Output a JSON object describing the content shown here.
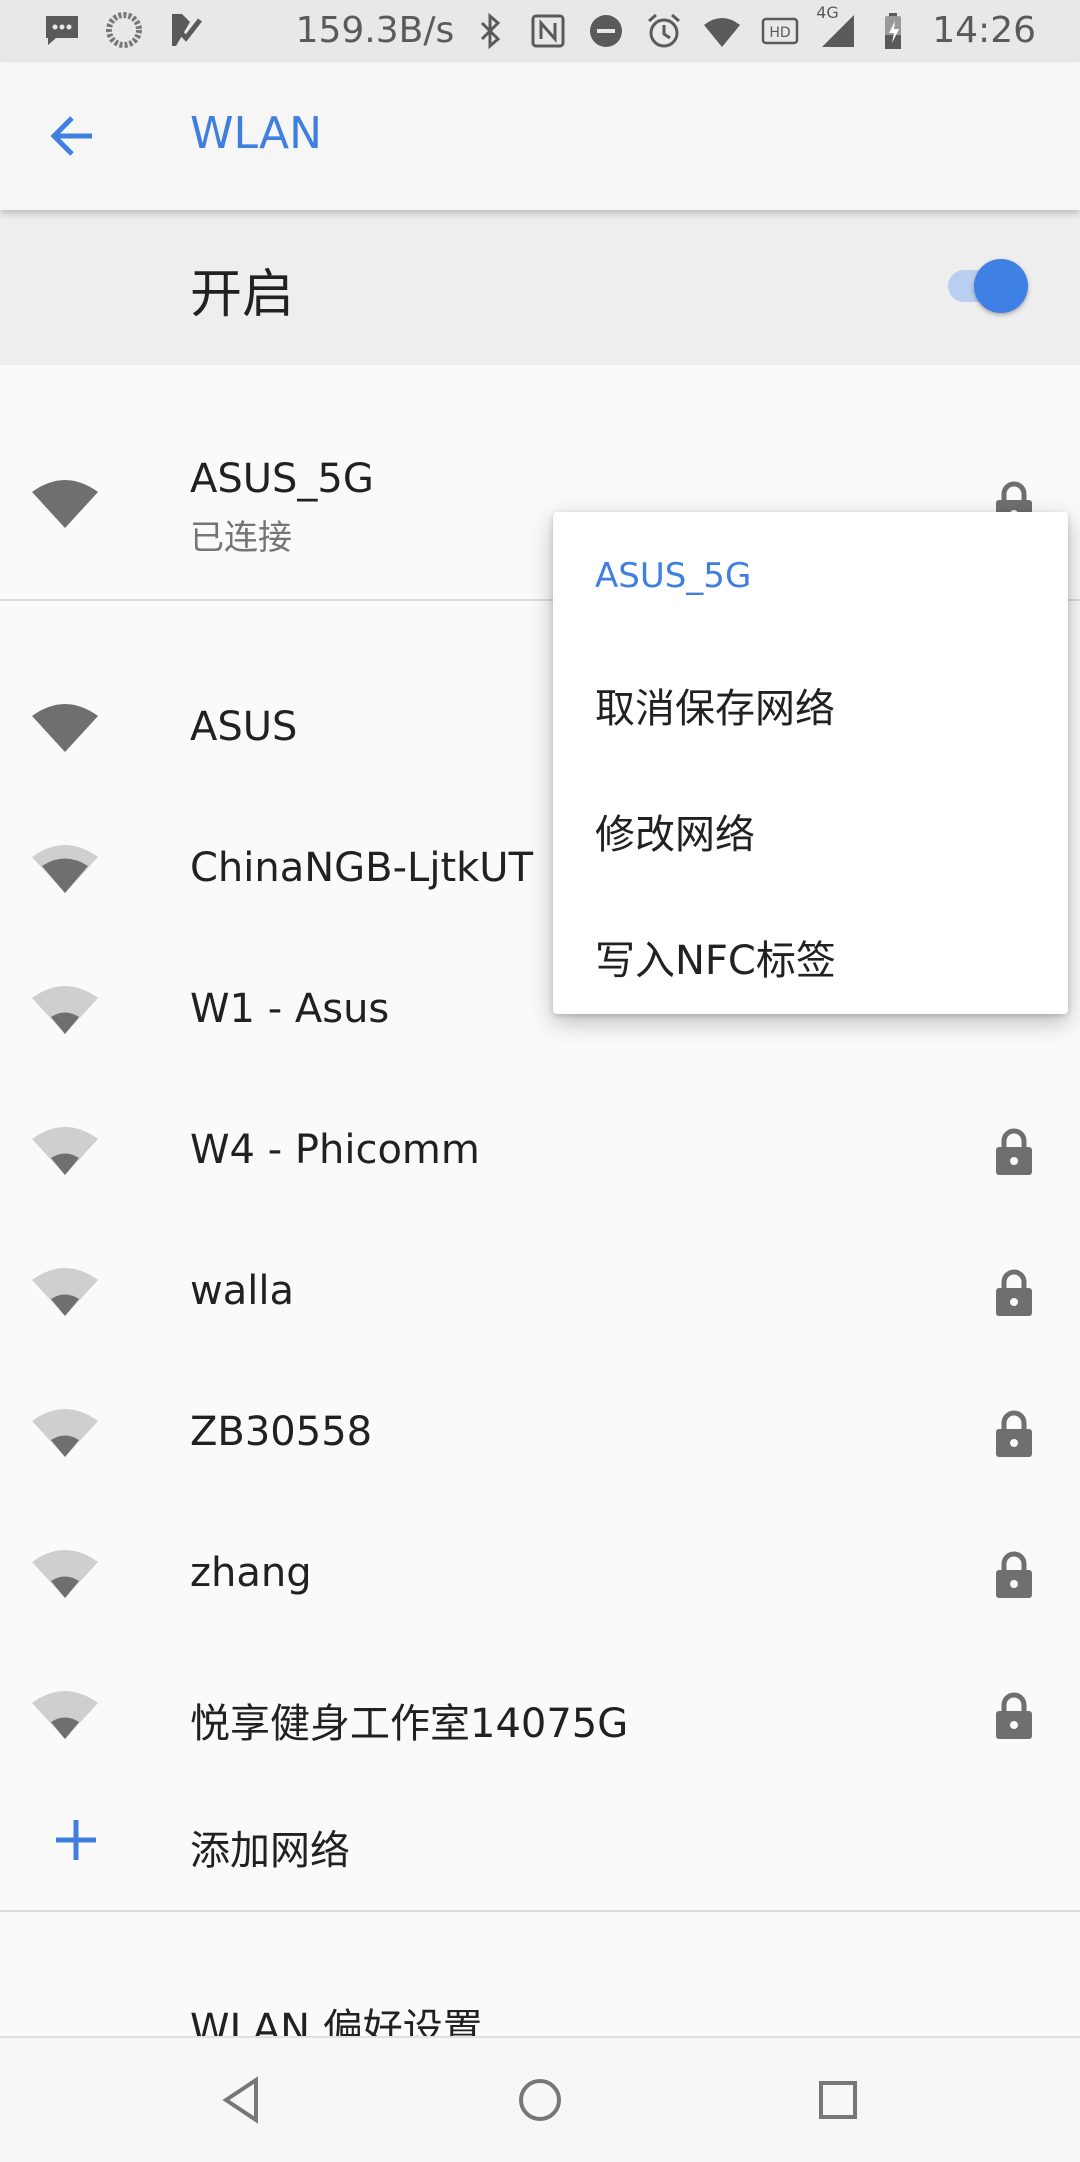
{
  "status_bar": {
    "speed": "159.3B/s",
    "network_type": "4G",
    "hd": "HD",
    "time": "14:26",
    "left_icons": [
      "message-icon",
      "sync-icon",
      "checklist-icon"
    ],
    "right_icons": [
      "bluetooth-icon",
      "nfc-icon",
      "dnd-icon",
      "alarm-icon",
      "wifi-icon",
      "signal-icon",
      "battery-icon"
    ]
  },
  "app_bar": {
    "title": "WLAN",
    "back_icon": "arrow-left-icon"
  },
  "wifi_switch": {
    "label": "开启",
    "enabled": true
  },
  "connected_network": {
    "ssid": "ASUS_5G",
    "status": "已连接",
    "secured": true
  },
  "networks": [
    {
      "ssid": "ASUS",
      "secured": false,
      "signal": 4
    },
    {
      "ssid": "ChinaNGB-LjtkUT",
      "secured": false,
      "signal": 3
    },
    {
      "ssid": "W1 - Asus",
      "secured": false,
      "signal": 2
    },
    {
      "ssid": "W4 - Phicomm",
      "secured": true,
      "signal": 2
    },
    {
      "ssid": "walla",
      "secured": true,
      "signal": 2
    },
    {
      "ssid": "ZB30558",
      "secured": true,
      "signal": 2
    },
    {
      "ssid": "zhang",
      "secured": true,
      "signal": 2
    },
    {
      "ssid": "悦享健身工作室14075G",
      "secured": true,
      "signal": 2
    }
  ],
  "add_network": {
    "label": "添加网络"
  },
  "preferences": {
    "label": "WLAN 偏好设置"
  },
  "context_menu": {
    "title": "ASUS_5G",
    "items": [
      "取消保存网络",
      "修改网络",
      "写入NFC标签"
    ]
  },
  "colors": {
    "accent": "#3f7fdf",
    "icon_gray": "#6f6f6f"
  }
}
